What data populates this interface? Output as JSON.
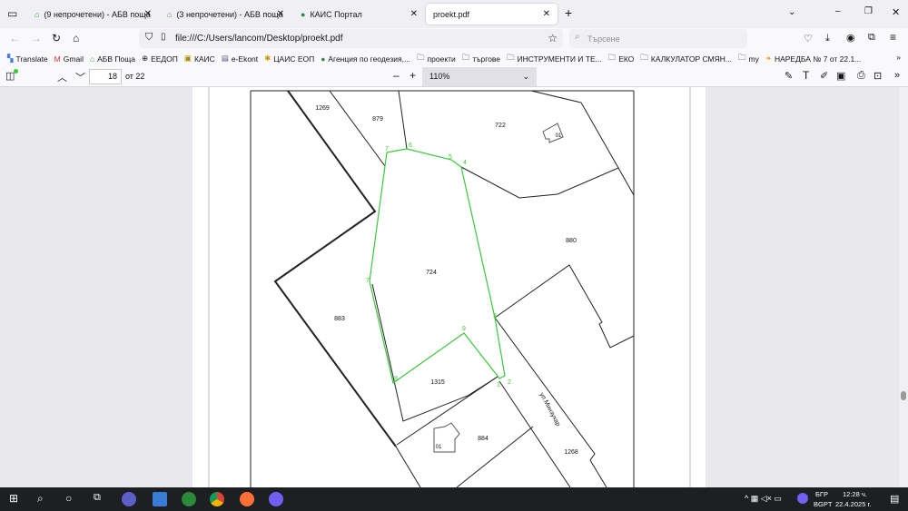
{
  "tabs": [
    {
      "label": "(9 непрочетени) - АБВ поща",
      "icon": "abv-home-icon"
    },
    {
      "label": "(3 непрочетени) - АБВ поща",
      "icon": "abv-home-icon"
    },
    {
      "label": "КАИС Портал",
      "icon": "kais-icon"
    },
    {
      "label": "proekt.pdf",
      "active": true
    }
  ],
  "nav": {
    "url": "file:///C:/Users/lancom/Desktop/proekt.pdf",
    "search_placeholder": "Търсене"
  },
  "bookmarks": [
    "Translate",
    "Gmail",
    "АБВ Поща",
    "ЕЕДОП",
    "КАИС",
    "e-Ekont",
    "ЦАИС ЕОП",
    "Агенция по геодезия,...",
    "проекти",
    "търгове",
    "ИНСТРУМЕНТИ И ТЕ...",
    "ЕКО",
    "КАЛКУЛАТОР СМЯН...",
    "my",
    "НАРЕДБА № 7 от 22.1..."
  ],
  "pdf": {
    "page": "18",
    "of": "от 22",
    "zoom": "110%"
  },
  "map": {
    "parcels": [
      "1269",
      "879",
      "722",
      "880",
      "724",
      "883",
      "1315",
      "884",
      "1268"
    ],
    "buildings": [
      "01",
      "01"
    ],
    "street": "ул.Минзухар",
    "vertices": [
      "7",
      "6",
      "5",
      "4",
      "3",
      "2",
      "1",
      "9",
      "8",
      "7"
    ],
    "boundary_color": "#3cc83c"
  },
  "taskbar": {
    "lang1": "БГР",
    "lang2": "BGPT",
    "time": "12:28 ч.",
    "date": "22.4.2025 г."
  }
}
